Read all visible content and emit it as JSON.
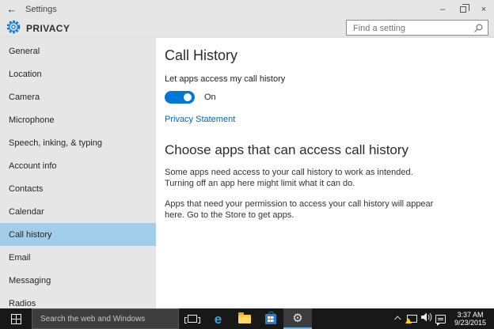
{
  "titlebar": {
    "title": "Settings",
    "back_icon": "←",
    "minimize_icon": "–",
    "close_icon": "×"
  },
  "header": {
    "app_title": "PRIVACY",
    "search_placeholder": "Find a setting"
  },
  "sidebar": {
    "items": [
      "General",
      "Location",
      "Camera",
      "Microphone",
      "Speech, inking, & typing",
      "Account info",
      "Contacts",
      "Calendar",
      "Call history",
      "Email",
      "Messaging",
      "Radios"
    ],
    "selected": "Call history"
  },
  "content": {
    "section1": {
      "title": "Call History",
      "toggle_label": "Let apps access my call history",
      "toggle_state": "On",
      "link": "Privacy Statement"
    },
    "section2": {
      "title": "Choose apps that can access call history",
      "para1": "Some apps need access to your call history to work as intended. Turning off an app here might limit what it can do.",
      "para2": "Apps that need your permission to access your call history will appear here. Go to the Store to get apps."
    }
  },
  "taskbar": {
    "search_placeholder": "Search the web and Windows",
    "edge_letter": "e",
    "gear_glyph": "⚙",
    "tray": {
      "time": "3:37 AM",
      "date": "9/23/2015"
    }
  },
  "colors": {
    "accent": "#0078d7",
    "selected_item": "#a2cde9",
    "chrome_gray": "#e6e6e6",
    "link_blue": "#0067b8",
    "taskbar_dark": "#181818",
    "warning_yellow": "#ffcc00"
  }
}
